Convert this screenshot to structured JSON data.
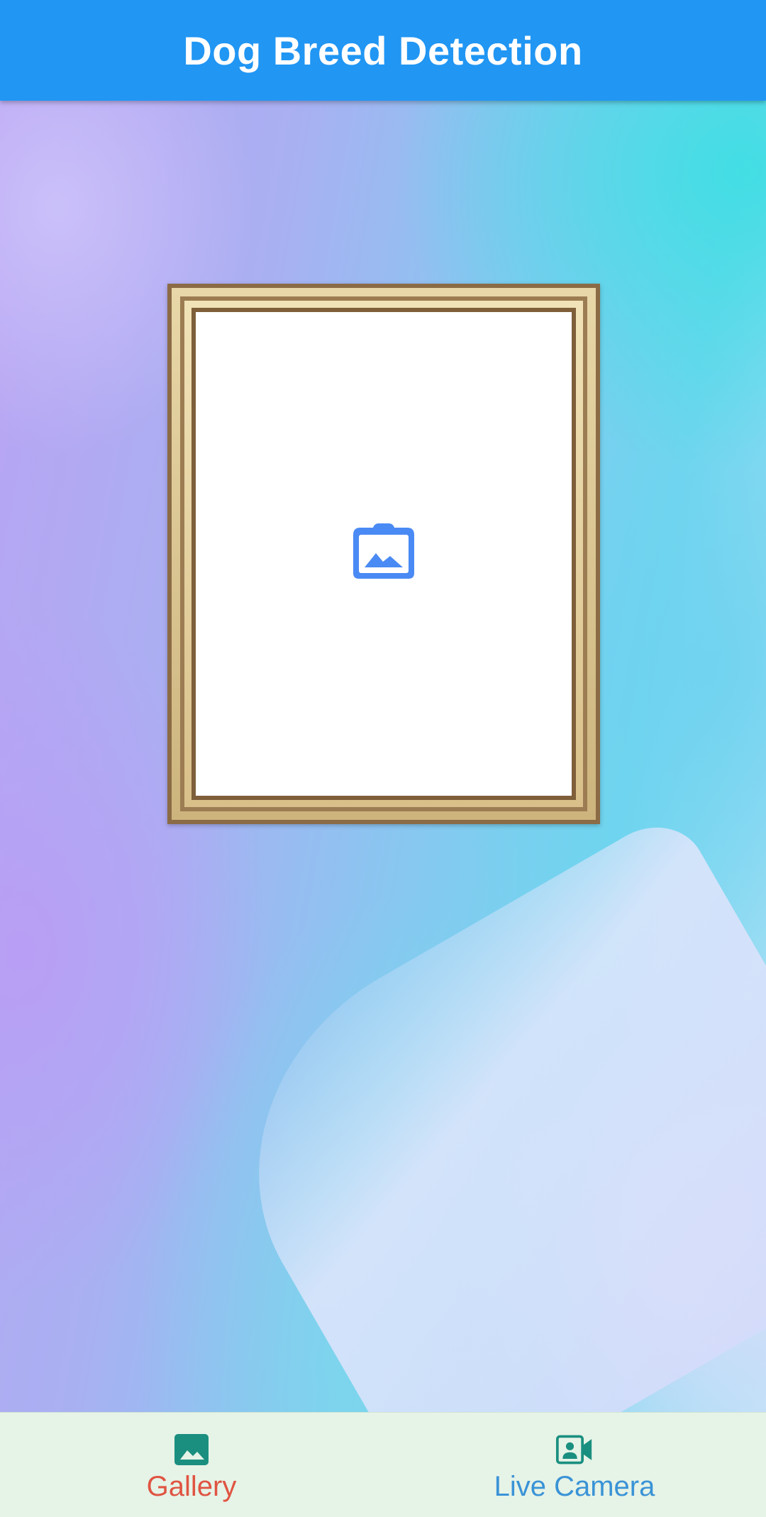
{
  "app_bar": {
    "title": "Dog Breed Detection"
  },
  "image_preview": {
    "icon": "image-placeholder-icon"
  },
  "bottom_nav": {
    "items": [
      {
        "label": "Gallery",
        "icon": "gallery-image-icon",
        "color": "#e05442",
        "selected": true
      },
      {
        "label": "Live Camera",
        "icon": "video-camera-icon",
        "color": "#3a93d6",
        "selected": false
      }
    ],
    "icon_color": "#1a8f80"
  },
  "colors": {
    "app_bar": "#2196f3",
    "placeholder_icon": "#4a8af4"
  }
}
